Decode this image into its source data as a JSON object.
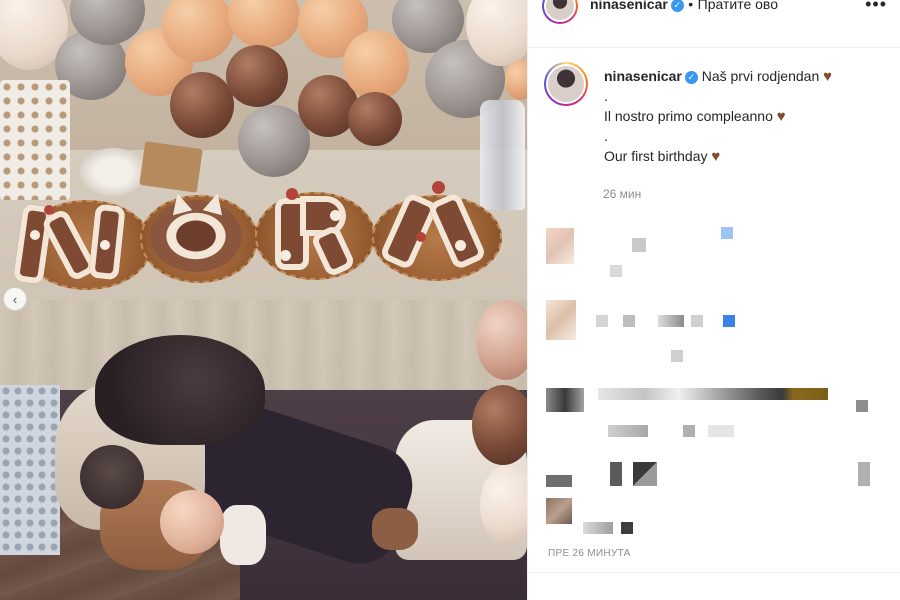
{
  "post": {
    "username": "ninasenicar",
    "verified_mark": "✓",
    "separator": "•",
    "follow_label": "Пратите ово",
    "more_icon": "•••",
    "carousel_prev_icon": "‹"
  },
  "caption": {
    "lines": [
      "Naš prvi rodjendan",
      ".",
      "Il nostro primo compleanno",
      ".",
      "Our first birthday"
    ],
    "heart_emoji": "♥",
    "time": "26 мин"
  },
  "footer": {
    "timestamp": "ПРЕ 26 МИНУТА"
  },
  "colors": {
    "verified": "#3897f0",
    "heart": "#7d4e2d",
    "muted_text": "#8e8e8e"
  }
}
